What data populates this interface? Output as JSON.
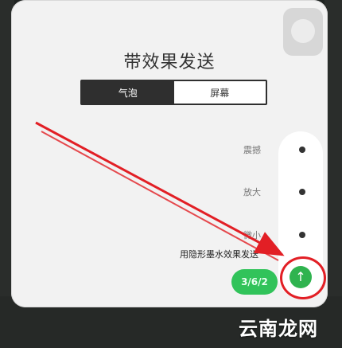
{
  "dialog": {
    "title": "带效果发送",
    "tabs": [
      {
        "label": "气泡",
        "active": true
      },
      {
        "label": "屏幕",
        "active": false
      }
    ],
    "effects": [
      {
        "label": "震撼"
      },
      {
        "label": "放大"
      },
      {
        "label": "微小"
      }
    ],
    "send_hint": "用隐形墨水效果发送",
    "message_bubble": "3/6/2",
    "send_icon": "arrow-up-icon"
  },
  "watermark": "云南龙网",
  "colors": {
    "accent_green": "#31c35a",
    "segment_dark": "#2f2f2f",
    "annotation_red": "#e21f25"
  }
}
